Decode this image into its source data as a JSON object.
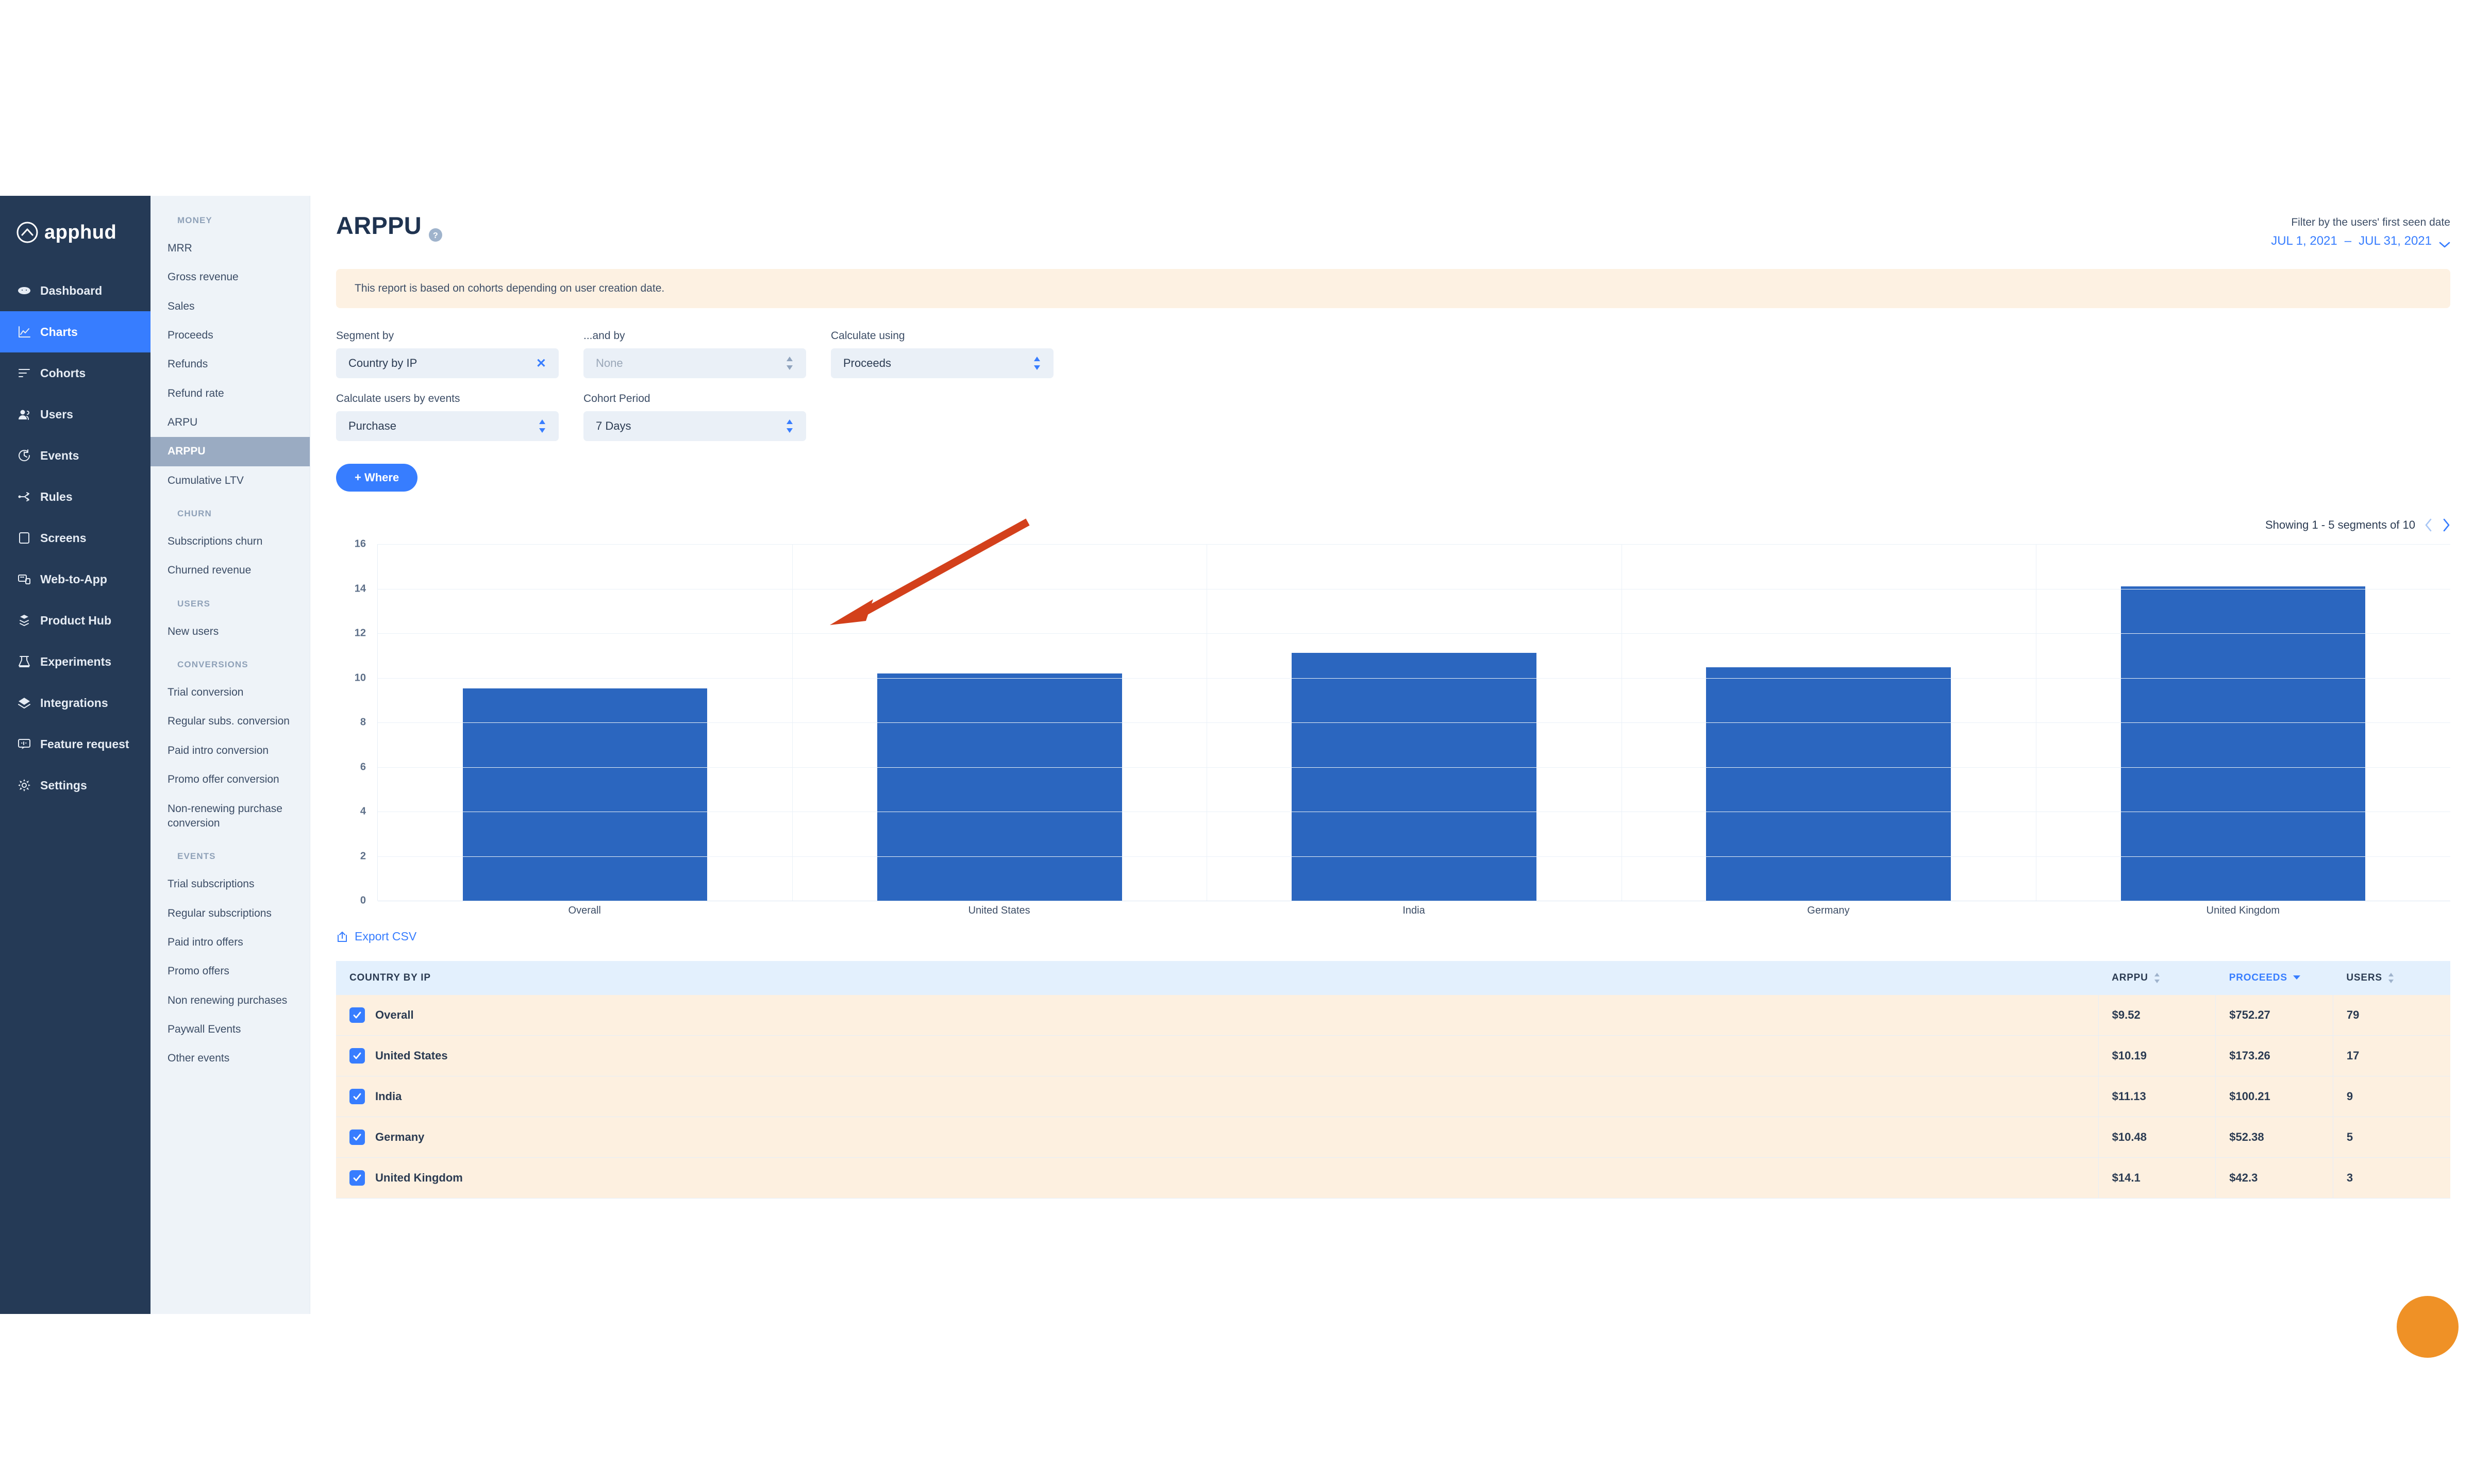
{
  "brand": {
    "name": "apphud",
    "accent": "#377dff",
    "sidebar_bg": "#253a56"
  },
  "sidebar": {
    "items": [
      {
        "label": "Dashboard",
        "icon": "dashboard-icon",
        "active": false
      },
      {
        "label": "Charts",
        "icon": "charts-icon",
        "active": true
      },
      {
        "label": "Cohorts",
        "icon": "cohorts-icon",
        "active": false
      },
      {
        "label": "Users",
        "icon": "users-icon",
        "active": false
      },
      {
        "label": "Events",
        "icon": "events-icon",
        "active": false
      },
      {
        "label": "Rules",
        "icon": "rules-icon",
        "active": false
      },
      {
        "label": "Screens",
        "icon": "screens-icon",
        "active": false
      },
      {
        "label": "Web-to-App",
        "icon": "web-to-app-icon",
        "active": false
      },
      {
        "label": "Product Hub",
        "icon": "product-hub-icon",
        "active": false
      },
      {
        "label": "Experiments",
        "icon": "experiments-icon",
        "active": false
      },
      {
        "label": "Integrations",
        "icon": "integrations-icon",
        "active": false
      },
      {
        "label": "Feature request",
        "icon": "feature-request-icon",
        "active": false
      },
      {
        "label": "Settings",
        "icon": "gear-icon",
        "active": false
      }
    ]
  },
  "subnav": {
    "groups": [
      {
        "title": "MONEY",
        "items": [
          {
            "label": "MRR",
            "active": false
          },
          {
            "label": "Gross revenue",
            "active": false
          },
          {
            "label": "Sales",
            "active": false
          },
          {
            "label": "Proceeds",
            "active": false
          },
          {
            "label": "Refunds",
            "active": false
          },
          {
            "label": "Refund rate",
            "active": false
          },
          {
            "label": "ARPU",
            "active": false
          },
          {
            "label": "ARPPU",
            "active": true
          },
          {
            "label": "Cumulative LTV",
            "active": false
          }
        ]
      },
      {
        "title": "CHURN",
        "items": [
          {
            "label": "Subscriptions churn",
            "active": false
          },
          {
            "label": "Churned revenue",
            "active": false
          }
        ]
      },
      {
        "title": "USERS",
        "items": [
          {
            "label": "New users",
            "active": false
          }
        ]
      },
      {
        "title": "CONVERSIONS",
        "items": [
          {
            "label": "Trial conversion",
            "active": false
          },
          {
            "label": "Regular subs. conversion",
            "active": false
          },
          {
            "label": "Paid intro conversion",
            "active": false
          },
          {
            "label": "Promo offer conversion",
            "active": false
          },
          {
            "label": "Non-renewing purchase conversion",
            "active": false
          }
        ]
      },
      {
        "title": "EVENTS",
        "items": [
          {
            "label": "Trial subscriptions",
            "active": false
          },
          {
            "label": "Regular subscriptions",
            "active": false
          },
          {
            "label": "Paid intro offers",
            "active": false
          },
          {
            "label": "Promo offers",
            "active": false
          },
          {
            "label": "Non renewing purchases",
            "active": false
          },
          {
            "label": "Paywall Events",
            "active": false
          },
          {
            "label": "Other events",
            "active": false
          }
        ]
      }
    ]
  },
  "header": {
    "title": "ARPPU",
    "help_icon": "help-icon",
    "date_filter_label": "Filter by the users' first seen date",
    "date_from": "JUL 1, 2021",
    "date_dash": "–",
    "date_to": "JUL 31, 2021"
  },
  "notice": {
    "text": "This report is based on cohorts depending on user creation date."
  },
  "controls": {
    "segment_by": {
      "label": "Segment by",
      "value": "Country by IP",
      "clear": "✕"
    },
    "and_by": {
      "label": "...and by",
      "value": "None",
      "is_placeholder": true
    },
    "calculate_using": {
      "label": "Calculate using",
      "value": "Proceeds"
    },
    "calculate_users_by_events": {
      "label": "Calculate users by events",
      "value": "Purchase"
    },
    "cohort_period": {
      "label": "Cohort Period",
      "value": "7 Days"
    },
    "where_button": "+ Where"
  },
  "chart_header": {
    "segments_text": "Showing 1 - 5 segments of 10",
    "prev_icon": "chevron-left-icon",
    "next_icon": "chevron-right-icon"
  },
  "chart_data": {
    "type": "bar",
    "title": "ARPPU",
    "xlabel": "",
    "ylabel": "",
    "categories": [
      "Overall",
      "United States",
      "India",
      "Germany",
      "United Kingdom"
    ],
    "values": [
      9.52,
      10.19,
      11.13,
      10.48,
      14.1
    ],
    "yticks": [
      16,
      14,
      12,
      10,
      8,
      6,
      4,
      2,
      0
    ],
    "ylim": [
      0,
      16
    ],
    "grid": true,
    "legend": "none",
    "bar_color": "#2b66bf"
  },
  "export": {
    "label": "Export CSV",
    "icon": "export-icon"
  },
  "table": {
    "columns": [
      {
        "key": "name",
        "label": "COUNTRY BY IP",
        "sortable": false,
        "sorted": false
      },
      {
        "key": "arppu",
        "label": "ARPPU",
        "sortable": true,
        "sorted": false
      },
      {
        "key": "proceeds",
        "label": "PROCEEDS",
        "sortable": true,
        "sorted": true
      },
      {
        "key": "users",
        "label": "USERS",
        "sortable": true,
        "sorted": false
      }
    ],
    "rows": [
      {
        "checked": true,
        "name": "Overall",
        "arppu": "$9.52",
        "proceeds": "$752.27",
        "users": "79"
      },
      {
        "checked": true,
        "name": "United States",
        "arppu": "$10.19",
        "proceeds": "$173.26",
        "users": "17"
      },
      {
        "checked": true,
        "name": "India",
        "arppu": "$11.13",
        "proceeds": "$100.21",
        "users": "9"
      },
      {
        "checked": true,
        "name": "Germany",
        "arppu": "$10.48",
        "proceeds": "$52.38",
        "users": "5"
      },
      {
        "checked": true,
        "name": "United Kingdom",
        "arppu": "$14.1",
        "proceeds": "$42.3",
        "users": "3"
      }
    ]
  },
  "annotation": {
    "type": "red-arrow",
    "color": "#d3401b"
  },
  "chat_widget": {
    "color": "#ef9126"
  }
}
